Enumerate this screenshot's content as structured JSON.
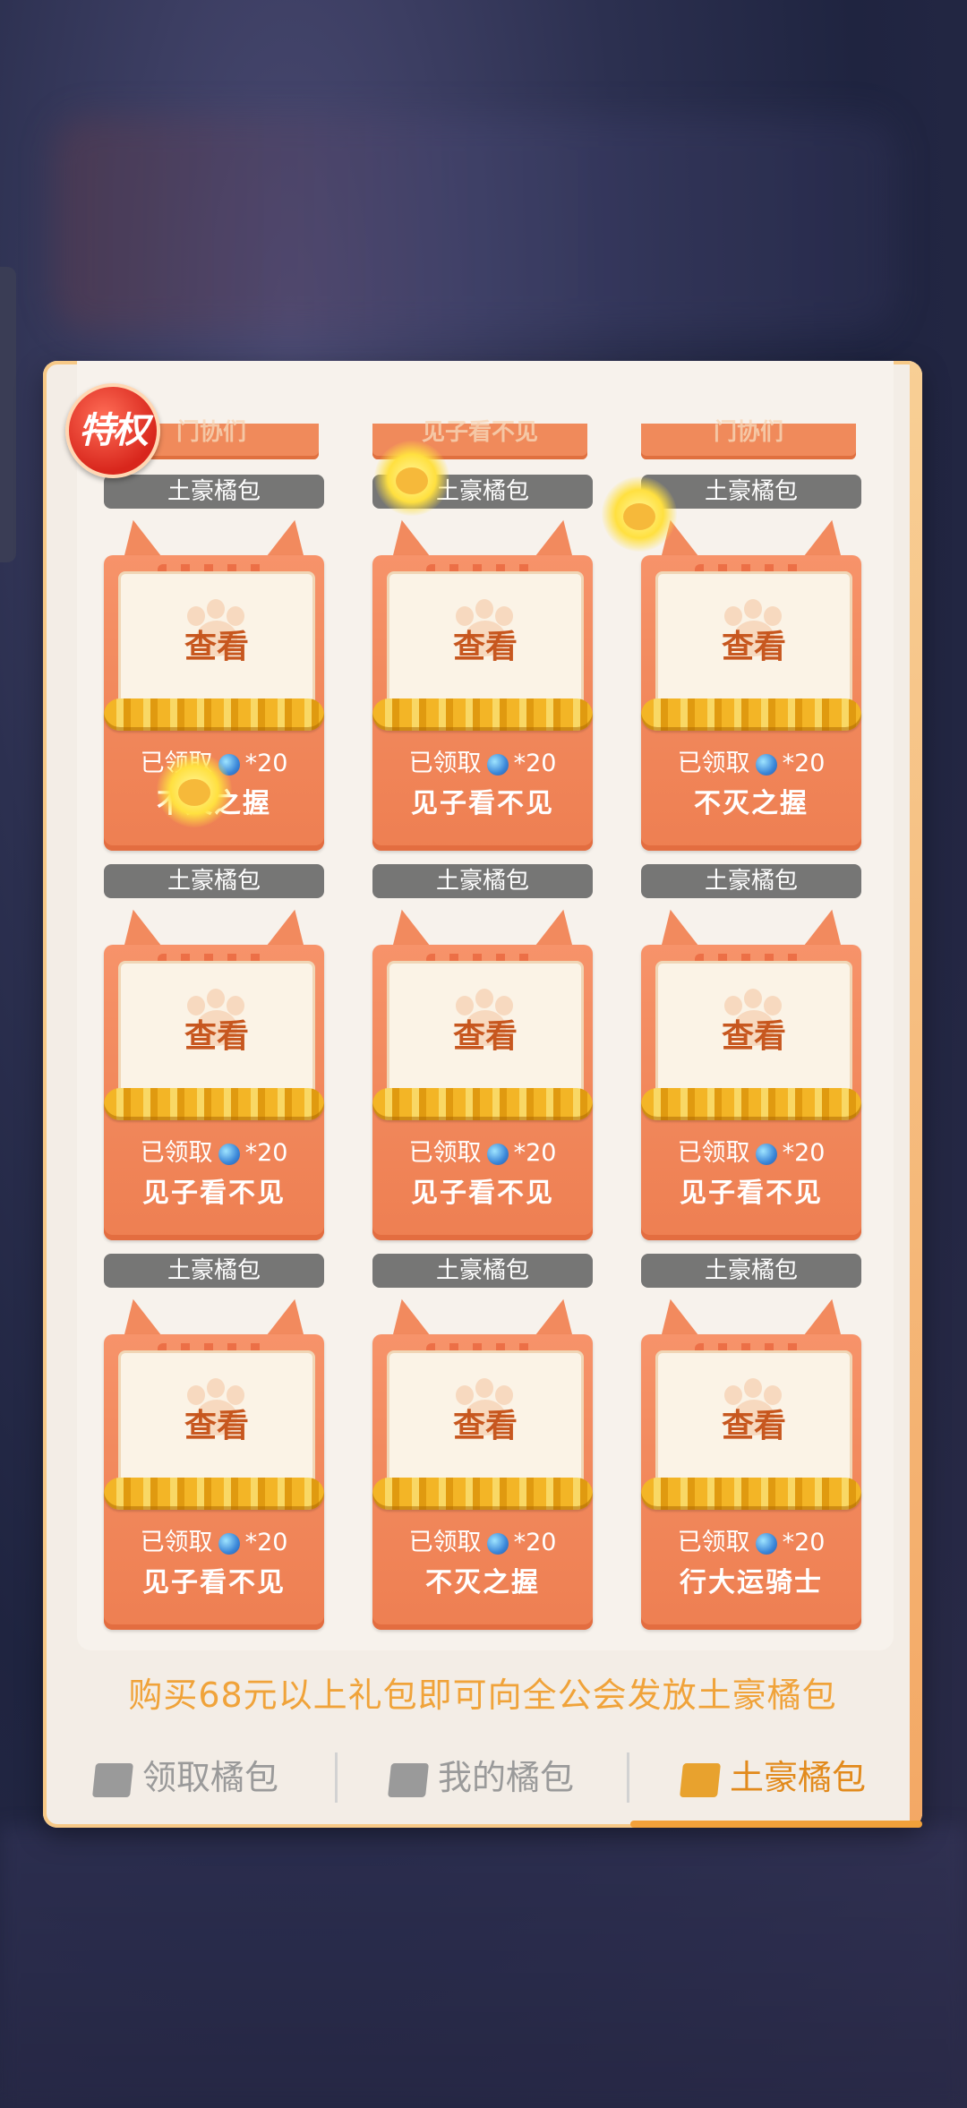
{
  "badge": "特权",
  "top_row_partial": [
    "门协们",
    "见子看不见",
    "门协们"
  ],
  "tag_label": "土豪橘包",
  "view_label": "查看",
  "cards": [
    {
      "status": "已领取",
      "amount": "*20",
      "sender": "不灭之握"
    },
    {
      "status": "已领取",
      "amount": "*20",
      "sender": "见子看不见"
    },
    {
      "status": "已领取",
      "amount": "*20",
      "sender": "不灭之握"
    },
    {
      "status": "已领取",
      "amount": "*20",
      "sender": "见子看不见"
    },
    {
      "status": "已领取",
      "amount": "*20",
      "sender": "见子看不见"
    },
    {
      "status": "已领取",
      "amount": "*20",
      "sender": "见子看不见"
    },
    {
      "status": "已领取",
      "amount": "*20",
      "sender": "见子看不见"
    },
    {
      "status": "已领取",
      "amount": "*20",
      "sender": "不灭之握"
    },
    {
      "status": "已领取",
      "amount": "*20",
      "sender": "行大运骑士"
    }
  ],
  "footer_text": "购买68元以上礼包即可向全公会发放土豪橘包",
  "tabs": [
    {
      "label": "领取橘包",
      "icon": "envelope-paw-icon",
      "active": false
    },
    {
      "label": "我的橘包",
      "icon": "envelope-icon",
      "active": false
    },
    {
      "label": "土豪橘包",
      "icon": "envelope-gold-icon",
      "active": true
    }
  ],
  "colors": {
    "accent": "#f0a33a",
    "card": "#f28a5e",
    "tag": "#767675"
  }
}
